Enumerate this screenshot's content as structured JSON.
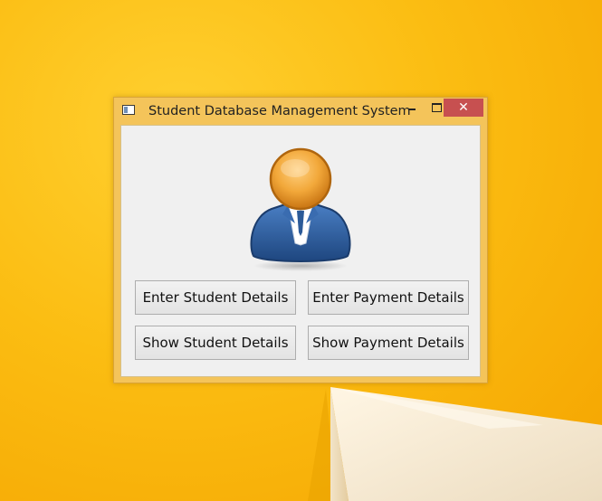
{
  "window": {
    "title": "Student Database Management System",
    "controls": {
      "minimize_icon": "minimize-icon",
      "maximize_icon": "maximize-icon",
      "close_label": "✕"
    }
  },
  "avatar_icon": "user-avatar-icon",
  "buttons": {
    "enter_student": "Enter Student Details",
    "enter_payment": "Enter Payment Details",
    "show_student": "Show Student Details",
    "show_payment": "Show Payment Details"
  },
  "colors": {
    "wallpaper": "#fbbd12",
    "title_bar": "#f4c45a",
    "close_button": "#c75050",
    "client_bg": "#f0f0f0",
    "avatar_head": "#f0a030",
    "avatar_body": "#2f5f9f"
  }
}
